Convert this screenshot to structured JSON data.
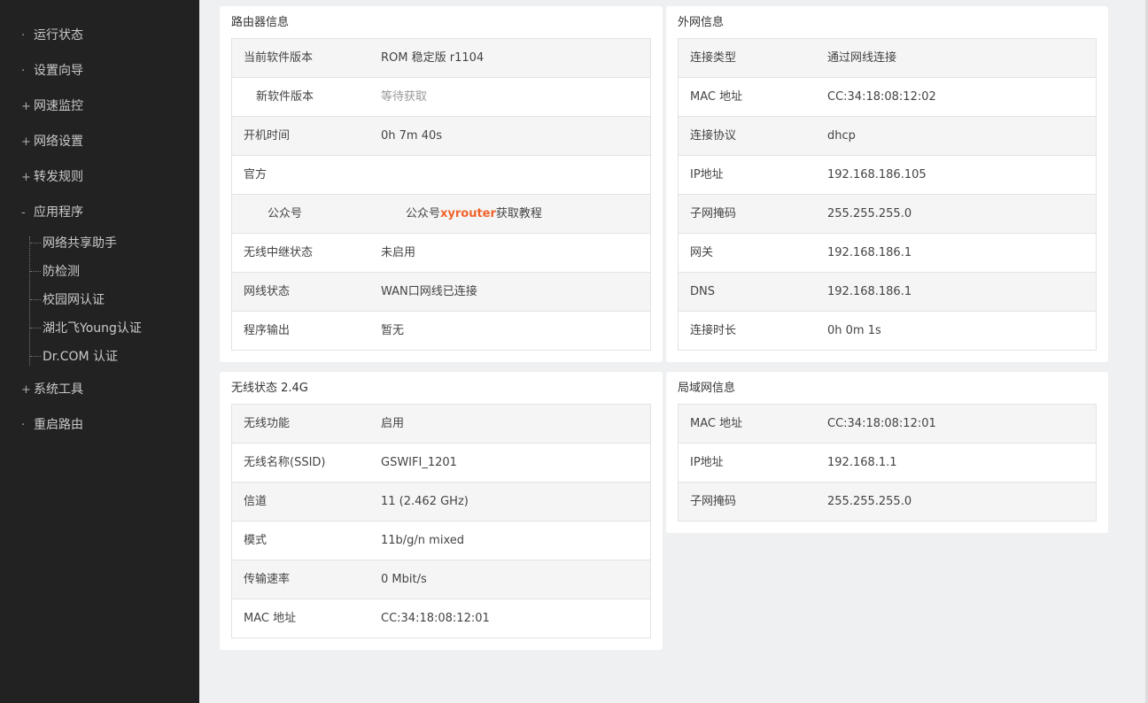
{
  "sidebar": {
    "items": [
      {
        "prefix": "·",
        "label": "运行状态"
      },
      {
        "prefix": "·",
        "label": "设置向导"
      },
      {
        "prefix": "+",
        "label": "网速监控"
      },
      {
        "prefix": "+",
        "label": "网络设置"
      },
      {
        "prefix": "+",
        "label": "转发规则"
      },
      {
        "prefix": "-",
        "label": "应用程序"
      },
      {
        "prefix": "+",
        "label": "系统工具"
      },
      {
        "prefix": "·",
        "label": "重启路由"
      }
    ],
    "app_subitems": [
      {
        "label": "网络共享助手"
      },
      {
        "label": "防检测"
      },
      {
        "label": "校园网认证"
      },
      {
        "label": "湖北飞Young认证"
      },
      {
        "label": "Dr.COM 认证"
      }
    ]
  },
  "router_info": {
    "title": "路由器信息",
    "rows": [
      {
        "key": "当前软件版本",
        "value": "ROM 稳定版 r1104"
      },
      {
        "key": "新软件版本",
        "value": "等待获取"
      },
      {
        "key": "开机时间",
        "value": "0h 7m 40s"
      },
      {
        "key": "官方",
        "value": ""
      },
      {
        "key": "公众号",
        "value_prefix": "公众号",
        "value_highlight": "xyrouter",
        "value_suffix": "获取教程"
      },
      {
        "key": "无线中继状态",
        "value": "未启用"
      },
      {
        "key": "网线状态",
        "value": "WAN口网线已连接"
      },
      {
        "key": "程序输出",
        "value": "暂无"
      }
    ]
  },
  "wan_info": {
    "title": "外网信息",
    "rows": [
      {
        "key": "连接类型",
        "value": "通过网线连接"
      },
      {
        "key": "MAC 地址",
        "value": "CC:34:18:08:12:02"
      },
      {
        "key": "连接协议",
        "value": "dhcp"
      },
      {
        "key": "IP地址",
        "value": "192.168.186.105"
      },
      {
        "key": "子网掩码",
        "value": "255.255.255.0"
      },
      {
        "key": "网关",
        "value": "192.168.186.1"
      },
      {
        "key": "DNS",
        "value": "192.168.186.1"
      },
      {
        "key": "连接时长",
        "value": "0h 0m 1s"
      }
    ]
  },
  "wireless_info": {
    "title": "无线状态 2.4G",
    "rows": [
      {
        "key": "无线功能",
        "value": "启用"
      },
      {
        "key": "无线名称(SSID)",
        "value": "GSWIFI_1201"
      },
      {
        "key": "信道",
        "value": "11 (2.462 GHz)"
      },
      {
        "key": "模式",
        "value": "11b/g/n mixed"
      },
      {
        "key": "传输速率",
        "value": "0 Mbit/s"
      },
      {
        "key": "MAC 地址",
        "value": "CC:34:18:08:12:01"
      }
    ]
  },
  "lan_info": {
    "title": "局域网信息",
    "rows": [
      {
        "key": "MAC 地址",
        "value": "CC:34:18:08:12:01"
      },
      {
        "key": "IP地址",
        "value": "192.168.1.1"
      },
      {
        "key": "子网掩码",
        "value": "255.255.255.0"
      }
    ]
  },
  "colors": {
    "sidebar_bg": "#222222",
    "page_bg": "#eef0f1",
    "accent": "#f0642d"
  }
}
